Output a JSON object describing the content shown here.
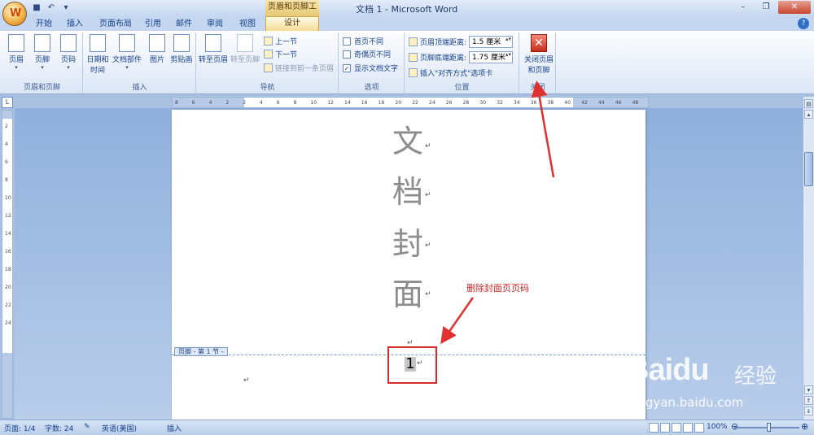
{
  "titlebar": {
    "context_tools": "页眉和页脚工具",
    "title": "文档 1 - Microsoft Word",
    "minimize": "–",
    "restore": "❐",
    "close": "✕"
  },
  "office_button": {
    "glyph": "W"
  },
  "qat": {
    "save": "■",
    "undo": "↶",
    "dropdown": "▾"
  },
  "tabs": [
    {
      "label": "开始"
    },
    {
      "label": "插入"
    },
    {
      "label": "页面布局"
    },
    {
      "label": "引用"
    },
    {
      "label": "邮件"
    },
    {
      "label": "审阅"
    },
    {
      "label": "视图"
    },
    {
      "label": "设计",
      "active": true
    }
  ],
  "ribbon": {
    "header_footer": {
      "label": "页眉和页脚",
      "header": "页眉",
      "footer": "页脚",
      "page_number": "页码"
    },
    "insert": {
      "label": "插入",
      "date_time": "日期和时间",
      "quick_parts": "文档部件",
      "picture": "图片",
      "clip_art": "剪贴画"
    },
    "navigation": {
      "label": "导航",
      "goto_header": "转至页眉",
      "goto_footer": "转至页脚",
      "prev_section": "上一节",
      "next_section": "下一节",
      "link_prev": "链接到前一条页眉"
    },
    "options": {
      "label": "选项",
      "diff_first": "首页不同",
      "diff_odd_even": "奇偶页不同",
      "show_text": "显示文档文字",
      "show_text_checked": "✓"
    },
    "position": {
      "label": "位置",
      "header_dist_label": "页眉顶端距离:",
      "header_dist_value": "1.5 厘米",
      "footer_dist_label": "页脚底端距离:",
      "footer_dist_value": "1.75 厘米",
      "insert_align_tab": "插入\"对齐方式\"选项卡"
    },
    "close": {
      "label": "关闭",
      "button_line1": "关闭页眉",
      "button_line2": "和页脚",
      "glyph": "✕"
    }
  },
  "ruler": {
    "corner": "L",
    "h_ticks": [
      "8",
      "6",
      "4",
      "2",
      "2",
      "4",
      "6",
      "8",
      "10",
      "12",
      "14",
      "16",
      "18",
      "20",
      "22",
      "24",
      "26",
      "28",
      "30",
      "32",
      "34",
      "36",
      "38",
      "40",
      "42",
      "44",
      "46",
      "48"
    ],
    "v_ticks": [
      "2",
      "4",
      "6",
      "8",
      "10",
      "12",
      "14",
      "16",
      "18",
      "20",
      "22",
      "24"
    ]
  },
  "document": {
    "cover_chars": [
      "文",
      "档",
      "封",
      "面"
    ],
    "para_mark": "↵",
    "footer_tag": "页脚 - 第 1 节 -",
    "page_number": "1",
    "annotation": "删除封面页页码"
  },
  "watermark": {
    "logo": "Baidu",
    "cn": "经验",
    "url": "jingyan.baidu.com"
  },
  "statusbar": {
    "page": "页面: 1/4",
    "words": "字数: 24",
    "language": "英语(美国)",
    "mode": "插入",
    "zoom": "100%"
  },
  "colors": {
    "accent_red": "#d42a2a",
    "ribbon_blue": "#15428b"
  }
}
